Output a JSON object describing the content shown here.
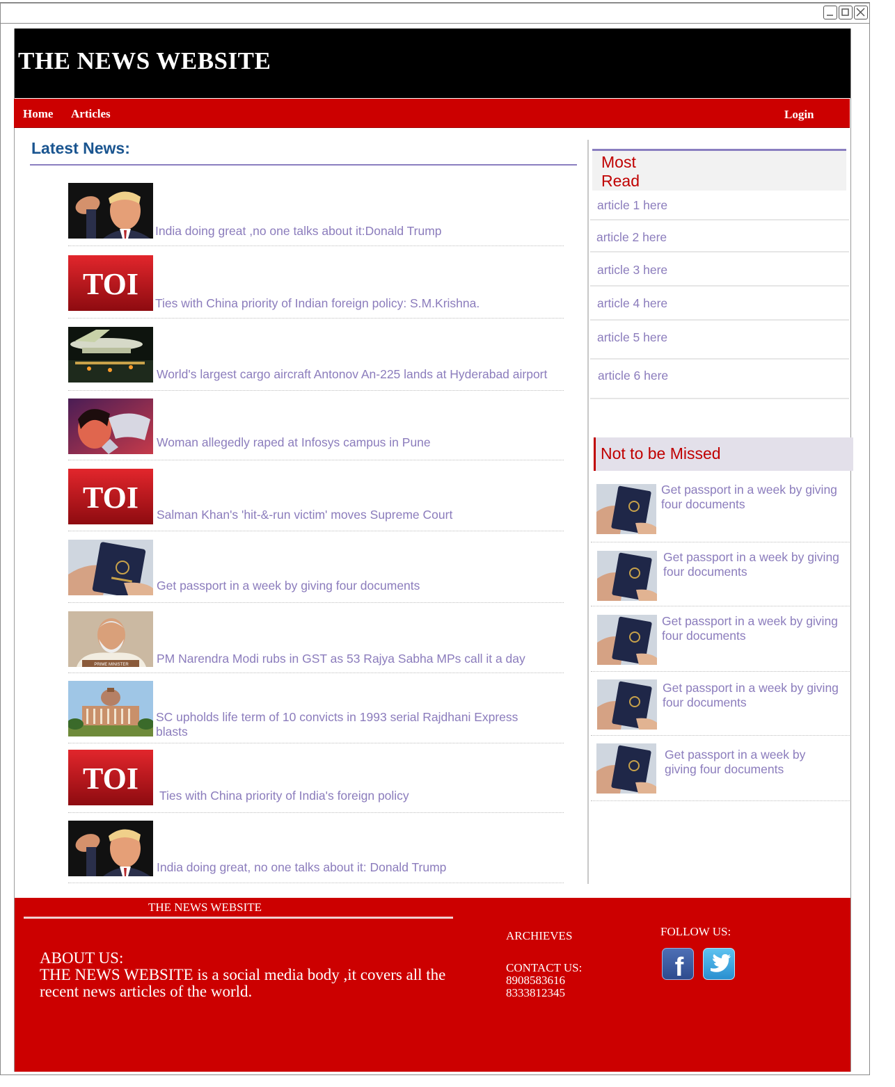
{
  "site": {
    "title": "THE NEWS WEBSITE"
  },
  "nav": {
    "home": "Home",
    "articles": "Articles",
    "login": "Login"
  },
  "main": {
    "heading": "Latest News:",
    "items": [
      {
        "text": "India doing great ,no one talks about it:Donald Trump",
        "thumb": "trump-photo"
      },
      {
        "text": "Ties with China priority of Indian foreign policy: S.M.Krishna.",
        "thumb": "toi-logo"
      },
      {
        "text": "World's largest cargo aircraft Antonov An-225 lands at Hyderabad airport",
        "thumb": "aircraft-photo"
      },
      {
        "text": "Woman allegedly raped at Infosys campus in Pune",
        "thumb": "woman-illustration"
      },
      {
        "text": "Salman Khan's 'hit-&-run victim' moves Supreme Court",
        "thumb": "toi-logo"
      },
      {
        "text": "Get passport in a week by giving four documents",
        "thumb": "passport-photo"
      },
      {
        "text": "PM Narendra Modi rubs in GST as 53 Rajya Sabha MPs call it a day",
        "thumb": "modi-photo"
      },
      {
        "text": "SC upholds life term of 10 convicts in 1993 serial Rajdhani Express blasts",
        "thumb": "supreme-court-photo"
      },
      {
        "text": "Ties with China priority of India's foreign policy",
        "thumb": "toi-logo"
      },
      {
        "text": "India doing great, no one talks about it: Donald Trump",
        "thumb": "trump-photo"
      }
    ],
    "toi_label": "TOI",
    "prime_minister_label": "PRIME MINISTER"
  },
  "sidebar": {
    "most_read_title": "Most Read",
    "most_read": [
      "article 1 here",
      "article 2 here",
      "article 3 here",
      "article 4 here",
      "article 5 here",
      "article 6 here"
    ],
    "not_missed_title": "Not to be Missed",
    "not_missed": [
      "Get passport in a week by giving four documents",
      "Get passport in a week by giving four documents",
      "Get passport in a week by giving four documents",
      "Get passport in a week by giving four documents",
      "Get passport in a week by giving four documents"
    ]
  },
  "footer": {
    "title": "THE NEWS WEBSITE",
    "about_heading": "ABOUT US:",
    "about_text": "THE NEWS WEBSITE is a social media body ,it covers all the recent news articles of the world.",
    "archives": "ARCHIEVES",
    "contact_heading": "CONTACT US:",
    "phone1": "8908583616",
    "phone2": "8333812345",
    "follow": "FOLLOW US:",
    "facebook_label": "f"
  },
  "colors": {
    "brand_red": "#cc0000",
    "header_black": "#000000",
    "link_purple": "#8b7cbc",
    "heading_blue": "#1a5590"
  }
}
